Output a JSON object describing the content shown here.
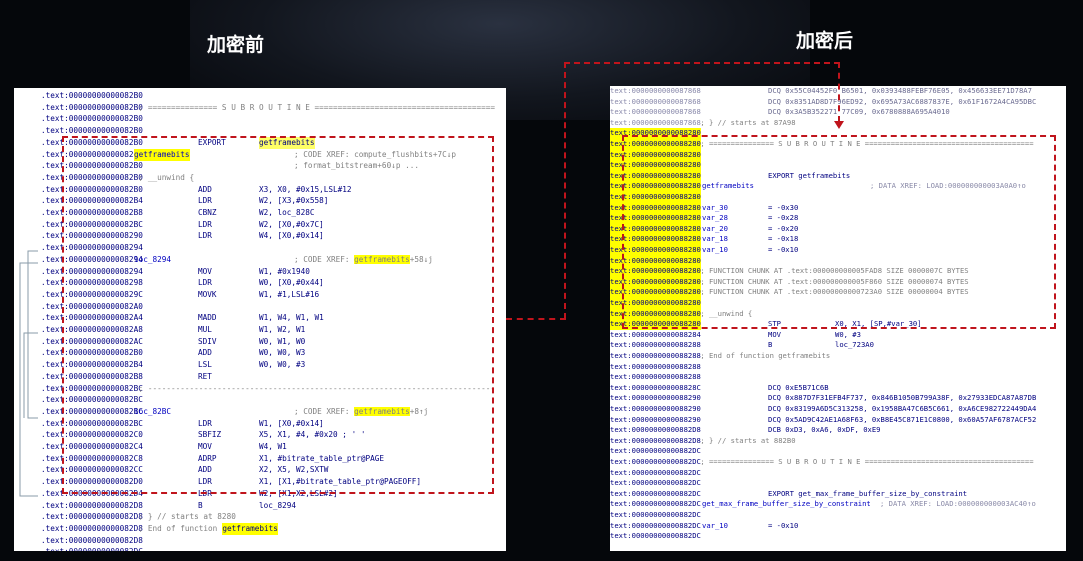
{
  "titles": {
    "before": "加密前",
    "after": "加密后"
  },
  "colors": {
    "highlight": "#ffff00",
    "dashed_border": "#c0141c",
    "address": "#000080",
    "comment": "#808080"
  },
  "left_lines": [
    {
      "addr": ".text:00000000000082B0",
      "text": ""
    },
    {
      "addr": ".text:00000000000082B0",
      "text": " ; =============== S U B R O U T I N E ======================================="
    },
    {
      "addr": ".text:00000000000082B0",
      "text": ""
    },
    {
      "addr": ".text:00000000000082B0",
      "text": ""
    },
    {
      "addr": ".text:00000000000082B0",
      "text": "",
      "mn": "EXPORT",
      "op": "getframebits",
      "hl_op": true
    },
    {
      "addr": ".text:00000000000082B0",
      "lbl": "getframebits",
      "hl_lbl": true,
      "cm": "; CODE XREF: compute_flushbits+7C↓p"
    },
    {
      "addr": ".text:00000000000082B0",
      "text": "",
      "cm": "; format_bitstream+60↓p ..."
    },
    {
      "addr": ".text:00000000000082B0",
      "text": " ; __unwind {"
    },
    {
      "addr": ".text:00000000000082B0",
      "mn": "ADD",
      "op": "X3, X0, #0x15,LSL#12"
    },
    {
      "addr": ".text:00000000000082B4",
      "mn": "LDR",
      "op": "W2, [X3,#0x558]"
    },
    {
      "addr": ".text:00000000000082B8",
      "mn": "CBNZ",
      "op": "W2, loc_828C"
    },
    {
      "addr": ".text:00000000000082BC",
      "mn": "LDR",
      "op": "W2, [X0,#0x7C]"
    },
    {
      "addr": ".text:0000000000008290",
      "mn": "LDR",
      "op": "W4, [X0,#0x14]"
    },
    {
      "addr": ".text:0000000000008294",
      "text": ""
    },
    {
      "addr": ".text:0000000000008294",
      "lbl": "loc_8294",
      "cm": "; CODE XREF: getframebits+58↓j",
      "hl_cm": "getframebits"
    },
    {
      "addr": ".text:0000000000008294",
      "mn": "MOV",
      "op": "W1, #0x1940"
    },
    {
      "addr": ".text:0000000000008298",
      "mn": "LDR",
      "op": "W0, [X0,#0x44]"
    },
    {
      "addr": ".text:000000000000829C",
      "mn": "MOVK",
      "op": "W1, #1,LSL#16"
    },
    {
      "addr": ".text:00000000000082A0",
      "text": ""
    },
    {
      "addr": ".text:00000000000082A4",
      "mn": "MADD",
      "op": "W1, W4, W1, W1"
    },
    {
      "addr": ".text:00000000000082A8",
      "mn": "MUL",
      "op": "W1, W2, W1"
    },
    {
      "addr": ".text:00000000000082AC",
      "mn": "SDIV",
      "op": "W0, W1, W0"
    },
    {
      "addr": ".text:00000000000082B0",
      "mn": "ADD",
      "op": "W0, W0, W3"
    },
    {
      "addr": ".text:00000000000082B4",
      "mn": "LSL",
      "op": "W0, W0, #3"
    },
    {
      "addr": ".text:00000000000082B8",
      "mn": "RET",
      "op": ""
    },
    {
      "addr": ".text:00000000000082BC",
      "text": " ; ---------------------------------------------------------------------------"
    },
    {
      "addr": ".text:00000000000082BC",
      "text": ""
    },
    {
      "addr": ".text:00000000000082BC",
      "lbl": "loc_82BC",
      "cm": "; CODE XREF: getframebits+8↑j",
      "hl_cm": "getframebits"
    },
    {
      "addr": ".text:00000000000082BC",
      "mn": "LDR",
      "op": "W1, [X0,#0x14]"
    },
    {
      "addr": ".text:00000000000082C0",
      "mn": "SBFIZ",
      "op": "X5, X1, #4, #0x20 ; ' '"
    },
    {
      "addr": ".text:00000000000082C4",
      "mn": "MOV",
      "op": "W4, W1"
    },
    {
      "addr": ".text:00000000000082C8",
      "mn": "ADRP",
      "op": "X1, #bitrate_table_ptr@PAGE"
    },
    {
      "addr": ".text:00000000000082CC",
      "mn": "ADD",
      "op": "X2, X5, W2,SXTW"
    },
    {
      "addr": ".text:00000000000082D0",
      "mn": "LDR",
      "op": "X1, [X1,#bitrate_table_ptr@PAGEOFF]"
    },
    {
      "addr": ".text:00000000000082D4",
      "mn": "LDR",
      "op": "W2, [X1,X2,LSL#2]"
    },
    {
      "addr": ".text:00000000000082D8",
      "mn": "B",
      "op": "loc_8294"
    },
    {
      "addr": ".text:00000000000082D8",
      "text": " ; } // starts at 8280"
    },
    {
      "addr": ".text:00000000000082D8",
      "text": " ; End of function ",
      "hl_tail": "getframebits"
    },
    {
      "addr": ".text:00000000000082D8",
      "text": ""
    },
    {
      "addr": ".text:00000000000082DC",
      "text": ""
    }
  ],
  "right_lines": [
    {
      "addr": "text:0000000000087868",
      "op": "DCQ 0x55C04452F0 B6501, 0x0393488FEBF76E05, 0x456633EE71D78A7",
      "dim": true
    },
    {
      "addr": "text:0000000000087868",
      "op": "DCQ 0x8351AD8D7F96ED92, 0x695A73AC6887837E, 0x61F1672A4CA95DBC",
      "dim": true
    },
    {
      "addr": "text:0000000000087868",
      "op": "DCQ 0x3A5B352271 77C09, 0x6780888A695A4010",
      "dim": true
    },
    {
      "addr": "text:0000000000087868",
      "text": " ; } // starts at 87A98",
      "dim": true
    },
    {
      "addr": "text:0000000000088280",
      "text": "",
      "hl_addr": true
    },
    {
      "addr": "text:0000000000088280",
      "text": " ; =============== S U B R O U T I N E =======================================",
      "hl_addr": true
    },
    {
      "addr": "text:0000000000088280",
      "text": "",
      "hl_addr": true
    },
    {
      "addr": "text:0000000000088280",
      "text": "",
      "hl_addr": true
    },
    {
      "addr": "text:0000000000088280",
      "op": "EXPORT getframebits",
      "hl_addr": true
    },
    {
      "addr": "text:0000000000088280",
      "lbl": "getframebits",
      "cm": "; DATA XREF: LOAD:000000000003A0A0↑o",
      "hl_addr": true
    },
    {
      "addr": "text:0000000000088280",
      "text": "",
      "hl_addr": true
    },
    {
      "addr": "text:0000000000088280",
      "lbl": "var_30",
      "op2": "= -0x30",
      "hl_addr": true
    },
    {
      "addr": "text:0000000000088280",
      "lbl": "var_28",
      "op2": "= -0x28",
      "hl_addr": true
    },
    {
      "addr": "text:0000000000088280",
      "lbl": "var_20",
      "op2": "= -0x20",
      "hl_addr": true
    },
    {
      "addr": "text:0000000000088280",
      "lbl": "var_18",
      "op2": "= -0x18",
      "hl_addr": true
    },
    {
      "addr": "text:0000000000088280",
      "lbl": "var_10",
      "op2": "= -0x10",
      "hl_addr": true
    },
    {
      "addr": "text:0000000000088280",
      "text": "",
      "hl_addr": true
    },
    {
      "addr": "text:0000000000088280",
      "text": " ; FUNCTION CHUNK AT .text:000000000005FAD8 SIZE 0000007C BYTES",
      "hl_addr": true,
      "grey": true
    },
    {
      "addr": "text:0000000000088280",
      "text": " ; FUNCTION CHUNK AT .text:000000000005F860 SIZE 00000074 BYTES",
      "hl_addr": true,
      "grey": true
    },
    {
      "addr": "text:0000000000088280",
      "text": " ; FUNCTION CHUNK AT .text:00000000000723A0 SIZE 00000004 BYTES",
      "hl_addr": true,
      "grey": true
    },
    {
      "addr": "text:0000000000088280",
      "text": "",
      "hl_addr": true
    },
    {
      "addr": "text:0000000000088280",
      "text": " ; __unwind {",
      "hl_addr": true
    },
    {
      "addr": "text:0000000000088280",
      "mn": "STP",
      "op": "X0, X1, [SP,#var_30]",
      "hl_addr": true
    },
    {
      "addr": "text:0000000000088284",
      "mn": "MOV",
      "op": "W0, #3"
    },
    {
      "addr": "text:0000000000088288",
      "mn": "B",
      "op": "loc_723A0"
    },
    {
      "addr": "text:0000000000088288",
      "text": " ; End of function getframebits"
    },
    {
      "addr": "text:0000000000088288",
      "text": ""
    },
    {
      "addr": "text:0000000000088288",
      "text": ""
    },
    {
      "addr": "text:000000000008828C",
      "op": "DCQ 0xE5B71C6B"
    },
    {
      "addr": "text:0000000000088290",
      "op": "DCQ 0x887D7F31EFB4F737, 0x846B1050B799A38F, 0x27933EDCA87A87DB"
    },
    {
      "addr": "text:0000000000088290",
      "op": "DCQ 0x83199A6D5C313258, 0x1958BA47C6B5C661, 0xA6CE982722449DA4"
    },
    {
      "addr": "text:0000000000088290",
      "op": "DCQ 0x5AD9C42AE1A68F63, 0xB8E45C871E1C0800, 0x60A57AF6787ACF52"
    },
    {
      "addr": "text:00000000000882D8",
      "op": "DCB 0xD3, 0xA6, 0xDF, 0xE9"
    },
    {
      "addr": "text:00000000000882D8",
      "text": " ; } // starts at 882B0"
    },
    {
      "addr": "text:00000000000882DC",
      "text": ""
    },
    {
      "addr": "text:00000000000882DC",
      "text": " ; =============== S U B R O U T I N E ======================================="
    },
    {
      "addr": "text:00000000000882DC",
      "text": ""
    },
    {
      "addr": "text:00000000000882DC",
      "text": ""
    },
    {
      "addr": "text:00000000000882DC",
      "op": "EXPORT get_max_frame_buffer_size_by_constraint"
    },
    {
      "addr": "text:00000000000882DC",
      "lbl": "get_max_frame_buffer_size_by_constraint",
      "cm": "; DATA XREF: LOAD:000000000003AC40↑o",
      "wide": true
    },
    {
      "addr": "text:00000000000882DC",
      "text": ""
    },
    {
      "addr": "text:00000000000882DC",
      "lbl": "var_10",
      "op2": "= -0x10"
    },
    {
      "addr": "text:00000000000882DC",
      "text": ""
    }
  ]
}
